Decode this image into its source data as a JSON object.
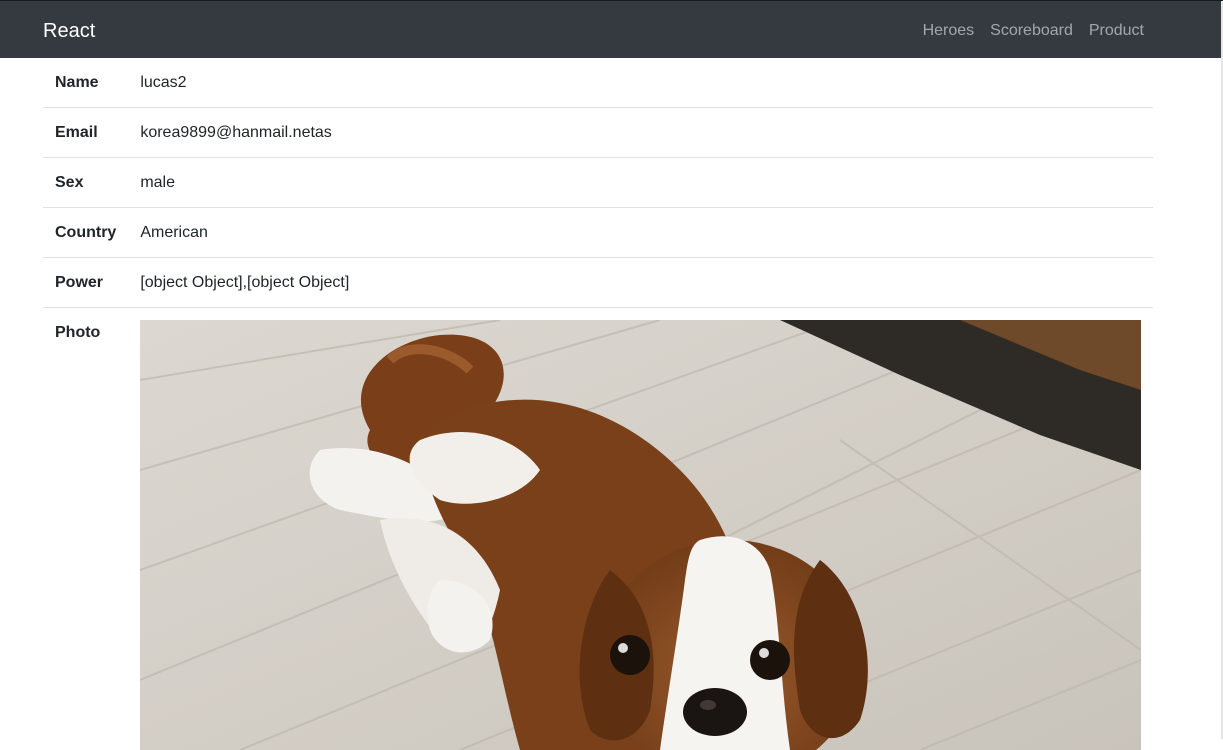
{
  "navbar": {
    "brand": "React",
    "links": [
      "Heroes",
      "Scoreboard",
      "Product"
    ]
  },
  "details": [
    {
      "label": "Name",
      "value": "lucas2"
    },
    {
      "label": "Email",
      "value": "korea9899@hanmail.netas"
    },
    {
      "label": "Sex",
      "value": "male"
    },
    {
      "label": "Country",
      "value": "American"
    },
    {
      "label": "Power",
      "value": "[object Object],[object Object]"
    }
  ],
  "photo": {
    "label": "Photo"
  },
  "colors": {
    "navbar_bg": "#343a40",
    "brand_text": "#ffffff",
    "nav_link_text": "#a0a3a6",
    "row_border": "#dee2e6",
    "text": "#212529"
  }
}
